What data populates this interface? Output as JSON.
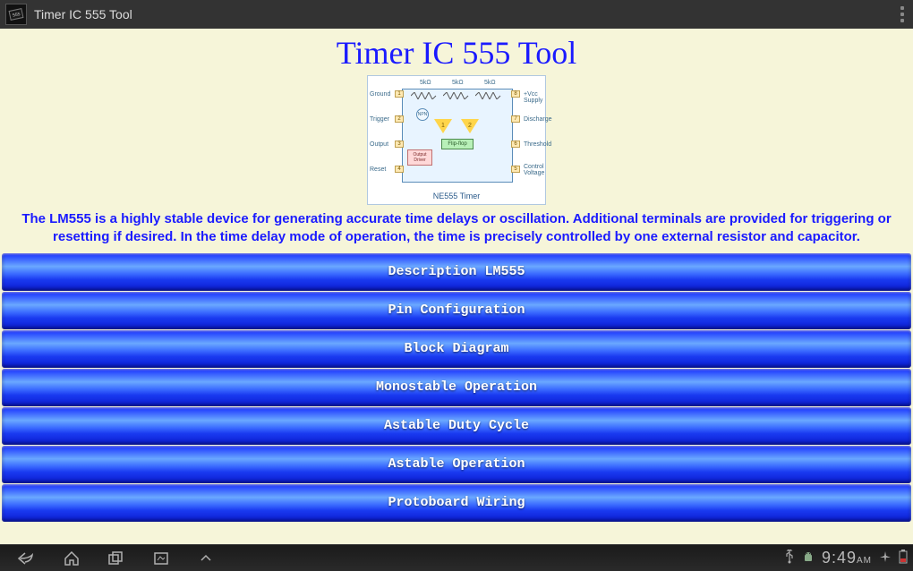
{
  "titlebar": {
    "title": "Timer IC 555 Tool"
  },
  "page": {
    "heading": "Timer IC 555 Tool",
    "description": "The LM555 is a highly stable device for generating accurate time delays or oscillation. Additional terminals are provided for triggering or resetting if desired. In the time delay mode of operation, the time is precisely controlled by one external resistor and capacitor."
  },
  "diagram": {
    "chip_label": "NE555 Timer",
    "top_labels": [
      "5kΩ",
      "5kΩ",
      "5kΩ"
    ],
    "pins_left": [
      {
        "num": "1",
        "label": "Ground"
      },
      {
        "num": "2",
        "label": "Trigger"
      },
      {
        "num": "3",
        "label": "Output"
      },
      {
        "num": "4",
        "label": "Reset"
      }
    ],
    "pins_right": [
      {
        "num": "8",
        "label": "+Vcc Supply"
      },
      {
        "num": "7",
        "label": "Discharge"
      },
      {
        "num": "6",
        "label": "Threshold"
      },
      {
        "num": "5",
        "label": "Control Voltage"
      }
    ],
    "flipflop": "Flip-flop",
    "output_driver": "Output Driver",
    "npn": "NPN",
    "tri1": "1",
    "tri2": "2"
  },
  "menu": {
    "items": [
      "Description LM555",
      "Pin Configuration",
      "Block Diagram",
      "Monostable Operation",
      "Astable Duty Cycle",
      "Astable Operation",
      "Protoboard Wiring"
    ]
  },
  "statusbar": {
    "time": "9:49",
    "ampm": "AM"
  }
}
